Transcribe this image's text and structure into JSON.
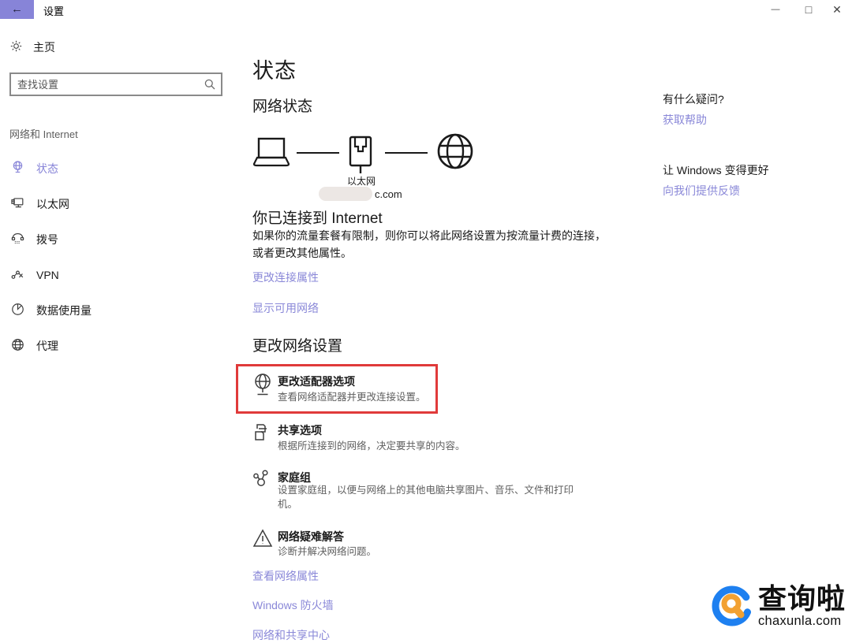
{
  "titlebar": {
    "title": "设置",
    "back_glyph": "←",
    "minimize_glyph": "—",
    "maximize_glyph": "□",
    "close_glyph": "✕"
  },
  "sidebar": {
    "home_label": "主页",
    "search_placeholder": "查找设置",
    "section_label": "网络和 Internet",
    "items": [
      {
        "label": "状态",
        "selected": true
      },
      {
        "label": "以太网",
        "selected": false
      },
      {
        "label": "拨号",
        "selected": false
      },
      {
        "label": "VPN",
        "selected": false
      },
      {
        "label": "数据使用量",
        "selected": false
      },
      {
        "label": "代理",
        "selected": false
      }
    ]
  },
  "main": {
    "page_title": "状态",
    "network_status_heading": "网络状态",
    "network_name": "以太网",
    "network_domain_suffix": "c.com",
    "connection_heading": "你已连接到 Internet",
    "connection_desc": "如果你的流量套餐有限制，则你可以将此网络设置为按流量计费的连接，或者更改其他属性。",
    "link_change_connection": "更改连接属性",
    "link_show_networks": "显示可用网络",
    "change_settings_heading": "更改网络设置",
    "settings_items": [
      {
        "title": "更改适配器选项",
        "desc": "查看网络适配器并更改连接设置。",
        "highlighted": true
      },
      {
        "title": "共享选项",
        "desc": "根据所连接到的网络，决定要共享的内容。",
        "highlighted": false
      },
      {
        "title": "家庭组",
        "desc": "设置家庭组，以便与网络上的其他电脑共享图片、音乐、文件和打印机。",
        "highlighted": false
      },
      {
        "title": "网络疑难解答",
        "desc": "诊断并解决网络问题。",
        "highlighted": false
      }
    ],
    "link_view_properties": "查看网络属性",
    "link_firewall": "Windows 防火墙",
    "link_sharing_center": "网络和共享中心"
  },
  "help_panel": {
    "question_heading": "有什么疑问?",
    "get_help_link": "获取帮助",
    "improve_heading": "让 Windows 变得更好",
    "feedback_link": "向我们提供反馈"
  },
  "watermark": {
    "name": "查询啦",
    "domain": "chaxunla.com"
  },
  "colors": {
    "accent_purple": "#8784d8",
    "link_purple": "#8a88d8",
    "highlight_red": "#e03a3a",
    "logo_blue": "#1e80f0",
    "logo_orange": "#f2a132"
  }
}
